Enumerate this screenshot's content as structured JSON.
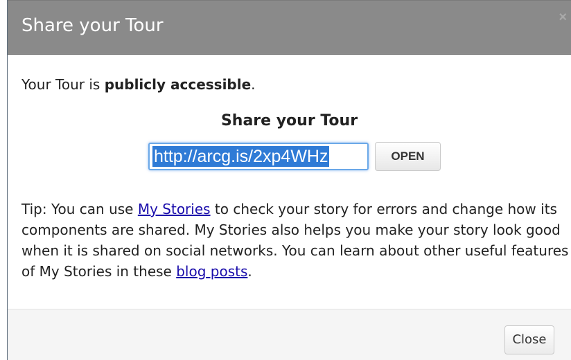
{
  "dialog": {
    "title": "Share your Tour",
    "close_glyph": "×"
  },
  "access": {
    "prefix": "Your Tour is ",
    "status": "publicly accessible",
    "suffix": "."
  },
  "share": {
    "heading": "Share your Tour",
    "url": "http://arcg.is/2xp4WHz",
    "open_label": "OPEN"
  },
  "tip": {
    "part1": "Tip: You can use ",
    "link1": "My Stories",
    "part2": " to check your story for errors and change how its components are shared. My Stories also helps you make your story look good when it is shared on social networks. You can learn about other useful features of My Stories in these ",
    "link2": "blog posts",
    "part3": "."
  },
  "footer": {
    "close_label": "Close"
  },
  "colors": {
    "header_bg": "#8a8a8a",
    "link": "#1a0dab",
    "selection": "#2f7bd6"
  }
}
